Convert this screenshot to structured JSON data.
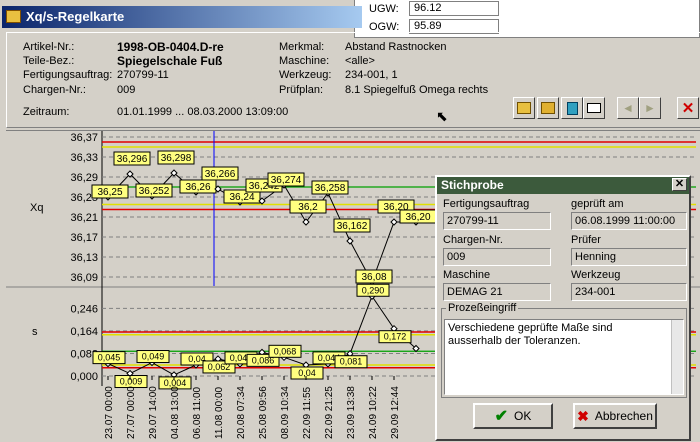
{
  "window": {
    "title": "Xq/s-Regelkarte"
  },
  "limits": {
    "ugw_label": "UGW:",
    "ugw_value": "96.12",
    "ogw_label": "OGW:",
    "ogw_value": "95.89"
  },
  "header": {
    "artikel_label": "Artikel-Nr.:",
    "artikel_value": "1998-OB-0404.D-re",
    "teile_label": "Teile-Bez.:",
    "teile_value": "Spiegelschale Fuß",
    "fa_label": "Fertigungsauftrag:",
    "fa_value": "270799-11",
    "chargen_label": "Chargen-Nr.:",
    "chargen_value": "009",
    "zeitraum_label": "Zeitraum:",
    "zeitraum_value": "01.01.1999  ...  08.03.2000 13:09:00",
    "merkmal_label": "Merkmal:",
    "merkmal_value": "Abstand Rastnocken",
    "maschine_label": "Maschine:",
    "maschine_value": "<alle>",
    "werkzeug_label": "Werkzeug:",
    "werkzeug_value": "234-001, 1",
    "pruefplan_label": "Prüfplan:",
    "pruefplan_value": "8.1 Spiegelfuß Omega rechts"
  },
  "toolbar": {
    "icons": [
      "chart-icon",
      "chart-settings-icon",
      "page-icon",
      "print-icon",
      "arrow-left-icon",
      "arrow-right-icon",
      "close-red-icon"
    ],
    "close_label": "✕"
  },
  "chart_data": [
    {
      "type": "line",
      "ylabel": "Xq",
      "yticks": [
        "36,37",
        "36,33",
        "36,29",
        "36,25",
        "36,21",
        "36,17",
        "36,13",
        "36,09"
      ],
      "ylim": [
        36.09,
        36.37
      ],
      "points": [
        36.25,
        36.296,
        36.252,
        36.298,
        36.26,
        36.266,
        36.24,
        36.242,
        36.274,
        36.2,
        36.258,
        36.162,
        36.08,
        36.2,
        36.2
      ],
      "labels": [
        "36,25",
        "36,296",
        "36,252",
        "36,298",
        "36,26",
        "36,266",
        "36,24",
        "36,242",
        "36,274",
        "36,2",
        "36,258",
        "36,162",
        "36,08",
        "36,20",
        "36,20"
      ]
    },
    {
      "type": "line",
      "ylabel": "s",
      "yticks": [
        "0,246",
        "0,164",
        "0,082",
        "0,000"
      ],
      "ylim": [
        0,
        0.28
      ],
      "points": [
        0.045,
        0.009,
        0.049,
        0.004,
        0.04,
        0.062,
        0.044,
        0.086,
        0.068,
        0.04,
        0.044,
        0.081,
        0.29,
        0.172,
        0.1
      ],
      "labels": [
        "0,045",
        "0,009",
        "0,049",
        "0,004",
        "0,04",
        "0,062",
        "0,044",
        "0,086",
        "0,068",
        "0,04",
        "0,044",
        "0,081",
        "0,290",
        "0,172",
        ""
      ],
      "xticks": [
        "23.07 00:00",
        "27.07 00:00",
        "29.07 14:00",
        "04.08 13:00",
        "06.08 11:00",
        "11.08 00:00",
        "20.08 07:34",
        "25.08 09:56",
        "08.09 10:34",
        "22.09 11:55",
        "22.09 21:25",
        "23.09 13:38",
        "24.09 10:22",
        "29.09 12:44"
      ]
    }
  ],
  "dialog": {
    "title": "Stichprobe",
    "fa_label": "Fertigungsauftrag",
    "fa_value": "270799-11",
    "geprueft_label": "geprüft am",
    "geprueft_value": "06.08.1999 11:00:00",
    "chargen_label": "Chargen-Nr.",
    "chargen_value": "009",
    "pruefer_label": "Prüfer",
    "pruefer_value": "Henning",
    "maschine_label": "Maschine",
    "maschine_value": "DEMAG 21",
    "werkzeug_label": "Werkzeug",
    "werkzeug_value": "234-001",
    "group_label": "Prozeßeingriff",
    "memo_text": "Verschiedene geprüfte Maße sind ausserhalb der Toleranzen.",
    "ok_label": "OK",
    "cancel_label": "Abbrechen"
  }
}
